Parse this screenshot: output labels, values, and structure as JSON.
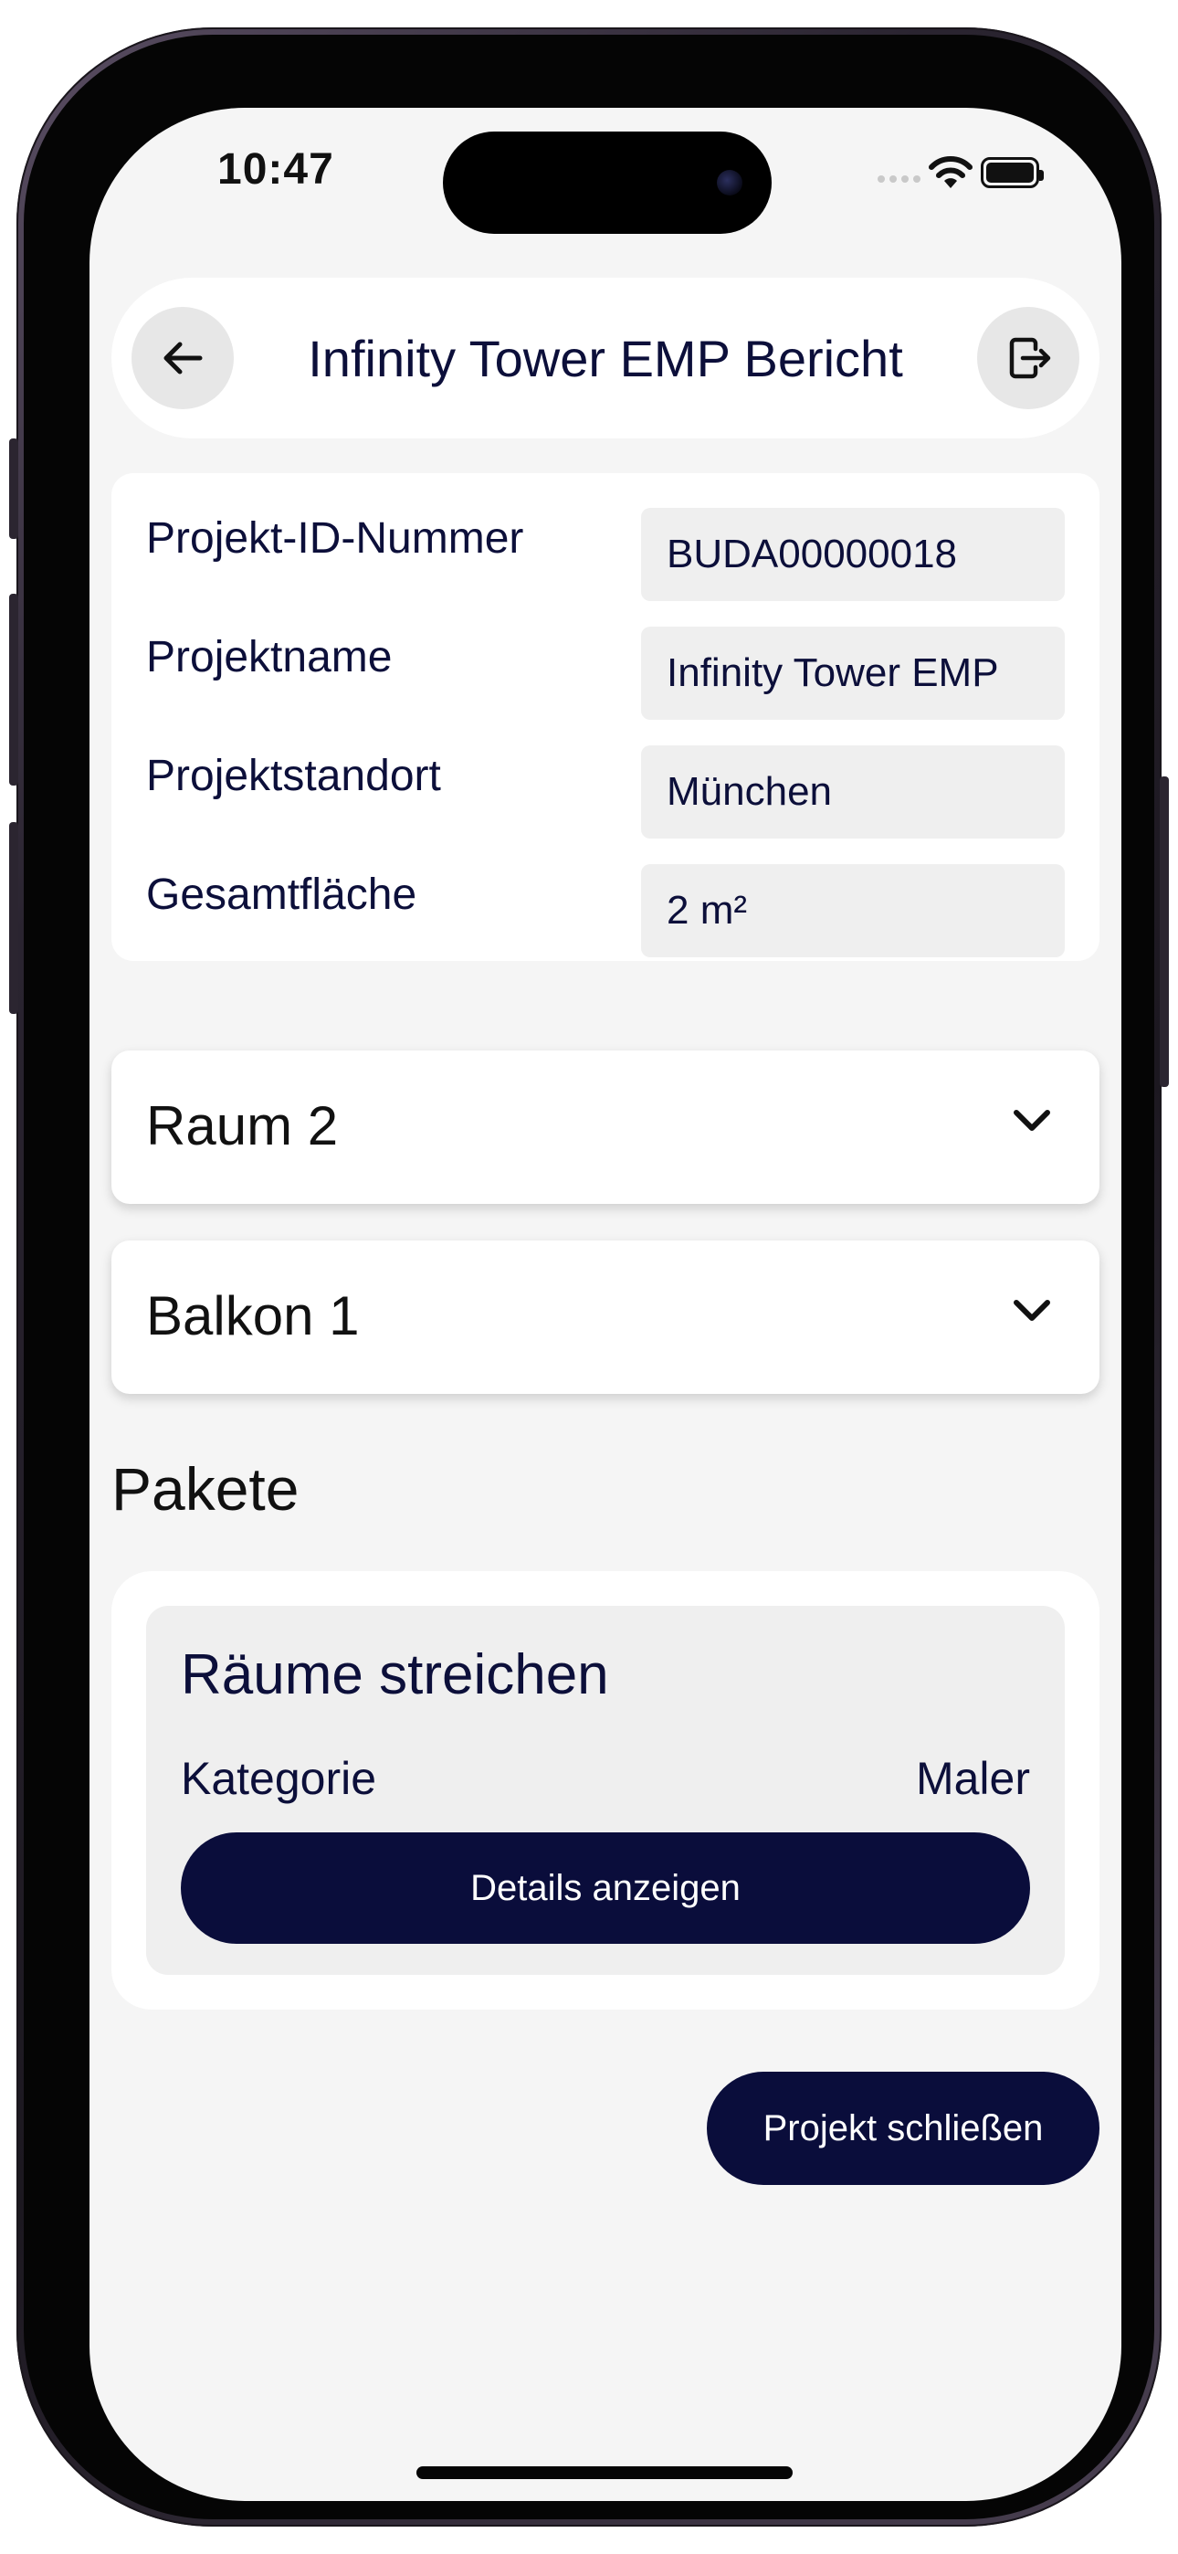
{
  "status_bar": {
    "time": "10:47"
  },
  "header": {
    "title": "Infinity Tower EMP Bericht",
    "back_icon": "arrow-left-icon",
    "export_icon": "document-export-icon"
  },
  "project_info": [
    {
      "label": "Projekt-ID-Nummer",
      "value": "BUDA00000018"
    },
    {
      "label": "Projektname",
      "value": "Infinity Tower EMP"
    },
    {
      "label": "Projektstandort",
      "value": "München"
    },
    {
      "label": "Gesamtfläche",
      "value": "2 m²"
    }
  ],
  "accordions": [
    {
      "label": "Raum 2"
    },
    {
      "label": "Balkon 1"
    }
  ],
  "packages_section": {
    "title": "Pakete",
    "items": [
      {
        "title": "Räume streichen",
        "category_label": "Kategorie",
        "category_value": "Maler",
        "button_label": "Details anzeigen"
      }
    ]
  },
  "footer": {
    "close_button_label": "Projekt schließen"
  },
  "colors": {
    "primary": "#0a0d3b",
    "screen_background": "#f5f5f5",
    "card_background": "#ffffff",
    "field_background": "#efefef"
  }
}
